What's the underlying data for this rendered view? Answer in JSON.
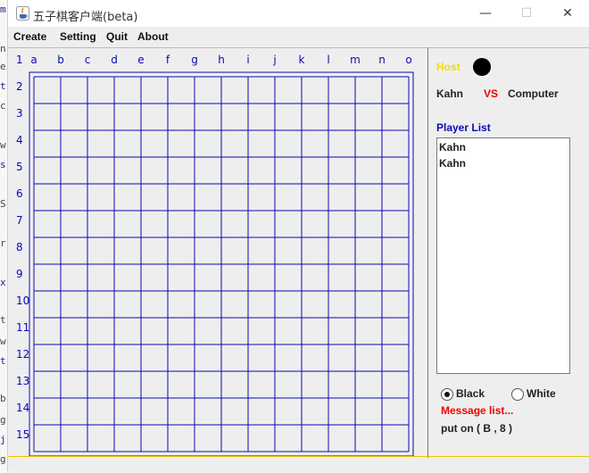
{
  "window": {
    "title": "五子棋客户端(beta)",
    "minimize_glyph": "—",
    "maximize_glyph": "☐",
    "close_glyph": "✕"
  },
  "background_ide": [
    "m",
    "n",
    "e",
    "t",
    "c",
    "w",
    "s",
    "S",
    "r",
    "x",
    "t",
    "w",
    "t",
    "b",
    "g",
    "j",
    "g"
  ],
  "menu": [
    "Create",
    "Setting",
    "Quit",
    "About"
  ],
  "board": {
    "columns": [
      "a",
      "b",
      "c",
      "d",
      "e",
      "f",
      "g",
      "h",
      "i",
      "j",
      "k",
      "l",
      "m",
      "n",
      "o"
    ],
    "rows": [
      "1",
      "2",
      "3",
      "4",
      "5",
      "6",
      "7",
      "8",
      "9",
      "10",
      "11",
      "12",
      "13",
      "14",
      "15"
    ],
    "line_color": "#0a0ab4"
  },
  "side": {
    "host_label": "Host",
    "host_color": "#f0e000",
    "host_stone_color": "#000000",
    "player_one": "Kahn",
    "vs_label": "VS",
    "vs_color": "#ee0000",
    "player_two": "Computer",
    "player_list_title": "Player List",
    "players": [
      "Kahn",
      "Kahn"
    ],
    "radio_black_label": "Black",
    "radio_black_selected": true,
    "radio_white_label": "White",
    "radio_white_selected": false,
    "message_title": "Message list...",
    "message_color": "#ee0000",
    "message_text": "put on ( B , 8 )"
  }
}
